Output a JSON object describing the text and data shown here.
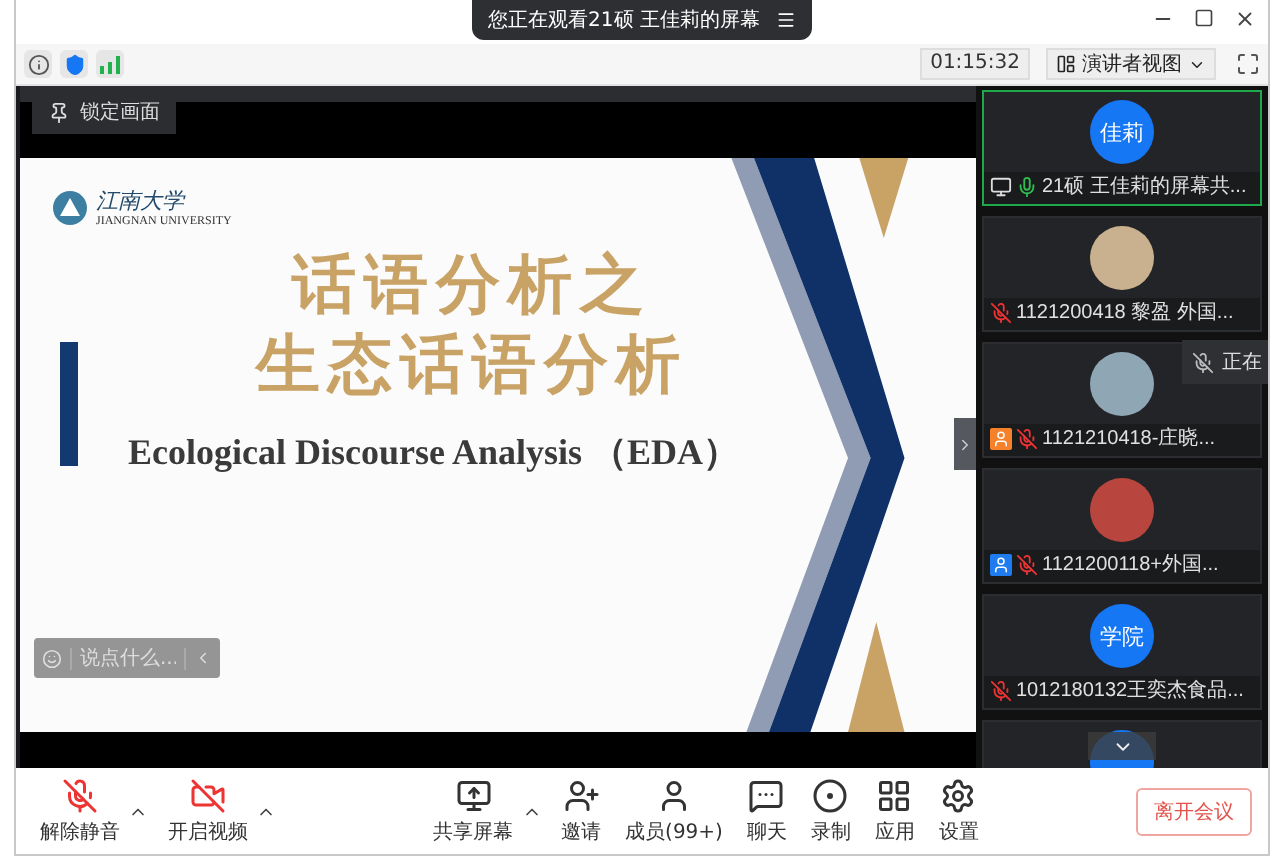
{
  "window": {
    "banner": "您正在观看21硕 王佳莉的屏幕"
  },
  "toolbar": {
    "timer": "01:15:32",
    "view_button": "演讲者视图"
  },
  "pin_button": "锁定画面",
  "slide": {
    "logo_text": "江南大学",
    "logo_subtext": "JIANGNAN UNIVERSITY",
    "title_lines": [
      "话语分析之",
      "生态话语分析"
    ],
    "subtitle": "Ecological Discourse Analysis （EDA）"
  },
  "chat_input": {
    "placeholder": "说点什么..."
  },
  "participants": [
    {
      "avatar": {
        "kind": "text",
        "text": "佳莉"
      },
      "name": "21硕 王佳莉的屏幕共...",
      "muted": false,
      "sharing": true,
      "selected": true
    },
    {
      "avatar": {
        "kind": "photo"
      },
      "name": "1121200418 黎盈 外国...",
      "muted": true,
      "sharing": false,
      "selected": false
    },
    {
      "avatar": {
        "kind": "photo"
      },
      "name": "1121210418-庄晓...",
      "muted": true,
      "sharing": false,
      "selected": false,
      "badge": {
        "color": "#f5812b"
      }
    },
    {
      "avatar": {
        "kind": "photo"
      },
      "name": "1121200118+外国...",
      "muted": true,
      "sharing": false,
      "selected": false,
      "badge": {
        "color": "#1f7cf0"
      }
    },
    {
      "avatar": {
        "kind": "text",
        "text": "学院"
      },
      "name": "1012180132王奕杰食品...",
      "muted": true,
      "sharing": false,
      "selected": false
    }
  ],
  "speaking_tooltip": "正在",
  "controls": [
    {
      "kind": "mic",
      "label": "解除静音",
      "off": true,
      "menu": true
    },
    {
      "kind": "video",
      "label": "开启视频",
      "off": true,
      "menu": true
    },
    {
      "kind": "share",
      "label": "共享屏幕",
      "menu": true
    },
    {
      "kind": "invite",
      "label": "邀请",
      "menu": false
    },
    {
      "kind": "members",
      "label": "成员(99+)",
      "menu": false
    },
    {
      "kind": "chat",
      "label": "聊天",
      "menu": false
    },
    {
      "kind": "record",
      "label": "录制",
      "menu": false
    },
    {
      "kind": "apps",
      "label": "应用",
      "menu": false
    },
    {
      "kind": "settings",
      "label": "设置",
      "menu": false
    }
  ],
  "leave_button": "离开会议"
}
